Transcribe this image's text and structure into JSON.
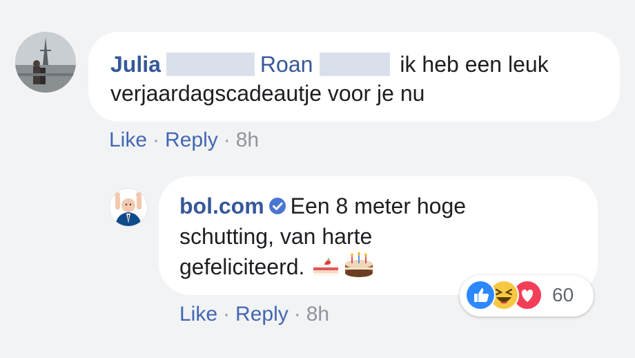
{
  "comment": {
    "author": "Julia",
    "mention": "Roan",
    "text_line1": "ik heb een leuk",
    "text_line2": "verjaardagscadeautje voor je nu",
    "actions": {
      "like": "Like",
      "reply": "Reply",
      "time": "8h"
    }
  },
  "reply": {
    "author": "bol.com",
    "verified": true,
    "text_line1": "Een 8 meter hoge",
    "text_line2": "schutting, van harte",
    "text_line3": "gefeliciteerd.",
    "emojis": [
      "shortcake-emoji",
      "birthday-cake-emoji"
    ],
    "actions": {
      "like": "Like",
      "reply": "Reply",
      "time": "8h"
    },
    "reactions": {
      "icons": [
        "like-icon",
        "haha-icon",
        "love-icon"
      ],
      "count": "60"
    }
  },
  "colors": {
    "link": "#365899",
    "action": "#4267b2",
    "meta": "#90949c",
    "background": "#f2f3f5"
  }
}
